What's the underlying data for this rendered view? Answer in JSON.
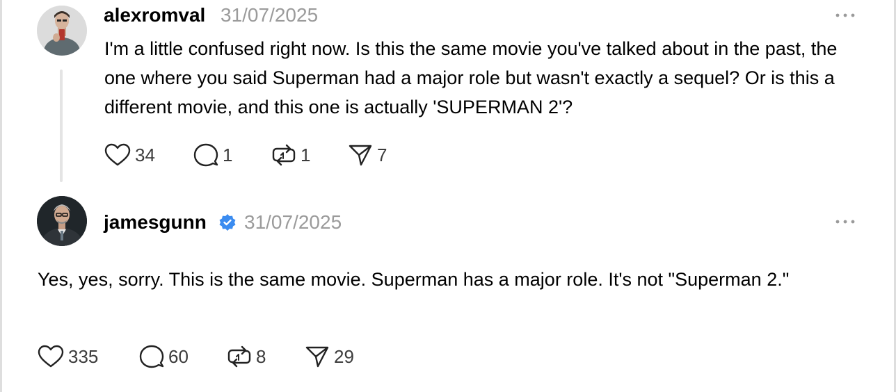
{
  "posts": [
    {
      "username": "alexromval",
      "date": "31/07/2025",
      "verified": false,
      "text": "I'm a little confused right now. Is this the same movie you've talked about in the past, the one where you said Superman had a major role but wasn't exactly a sequel? Or is this a different movie, and this one is actually 'SUPERMAN 2'?",
      "likes": "34",
      "replies": "1",
      "reposts": "1",
      "shares": "7"
    },
    {
      "username": "jamesgunn",
      "date": "31/07/2025",
      "verified": true,
      "text": "Yes, yes, sorry. This is the same movie. Superman has a major role. It's not \"Superman 2.\"",
      "likes": "335",
      "replies": "60",
      "reposts": "8",
      "shares": "29"
    }
  ],
  "icons": {
    "like": "heart-icon",
    "reply": "comment-bubble-icon",
    "repost": "repost-icon",
    "share": "send-icon",
    "more": "more-dots-icon",
    "verified": "verified-badge-icon"
  },
  "colors": {
    "verified": "#3b8cf0",
    "timestamp": "#9b9b9b",
    "thread_line": "#e4e4e4"
  }
}
